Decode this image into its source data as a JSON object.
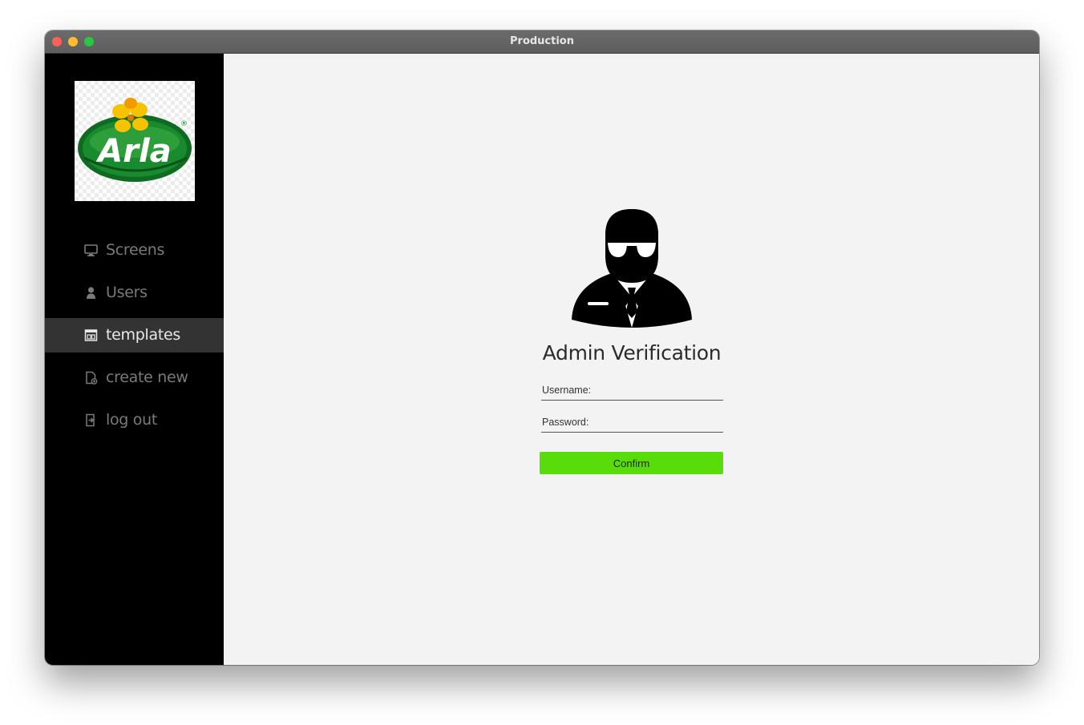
{
  "window": {
    "title": "Production"
  },
  "logo": {
    "text": "Arla",
    "registered_mark": "®",
    "colors": {
      "green": "#1a8a2e",
      "yellow": "#f7c300"
    }
  },
  "sidebar": {
    "items": [
      {
        "label": "Screens",
        "icon": "monitor-icon",
        "active": false
      },
      {
        "label": "Users",
        "icon": "user-icon",
        "active": false
      },
      {
        "label": "templates",
        "icon": "template-icon",
        "active": true
      },
      {
        "label": "create new",
        "icon": "new-file-icon",
        "active": false
      },
      {
        "label": "log out",
        "icon": "logout-icon",
        "active": false
      }
    ]
  },
  "main": {
    "avatar_icon": "admin-agent-icon",
    "heading": "Admin Verification",
    "username": {
      "placeholder": "Username:",
      "value": ""
    },
    "password": {
      "placeholder": "Password:",
      "value": ""
    },
    "confirm_label": "Confirm",
    "accent_color": "#58dd0b"
  }
}
